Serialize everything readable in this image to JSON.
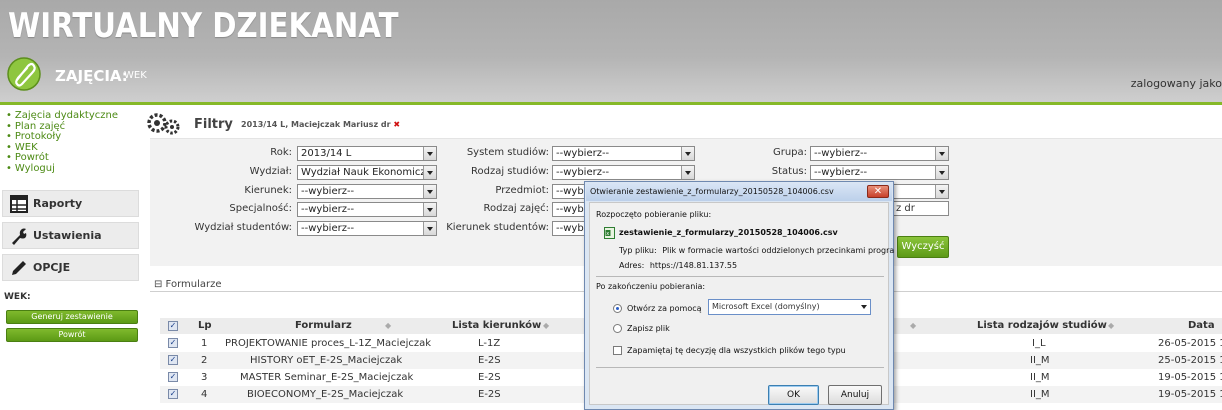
{
  "app": {
    "title": "WIRTUALNY DZIEKANAT",
    "section": "ZAJĘCIA:",
    "section_sub": "WEK",
    "user_label": "zalogowany jako"
  },
  "colors": {
    "accent": "#86b928",
    "nav_link": "#4c8a14",
    "close_x": "#d01010"
  },
  "sidebar": {
    "nav": [
      "Zajęcia dydaktyczne",
      "Plan zajęć",
      "Protokoły",
      "WEK",
      "Powrót",
      "Wyloguj"
    ],
    "buttons": [
      {
        "label": "Raporty",
        "icon": "table-icon"
      },
      {
        "label": "Ustawienia",
        "icon": "wrench-icon"
      },
      {
        "label": "OPCJE",
        "icon": "pencil-icon"
      }
    ],
    "wek_label": "WEK:",
    "generate_label": "Generuj zestawienie",
    "back_label": "Powrót"
  },
  "filters": {
    "title": "Filtry",
    "subtitle": "2013/14 L,   Maciejczak Mariusz dr",
    "rok_label": "Rok:",
    "rok_value": "2013/14 L",
    "wydzial_label": "Wydział:",
    "wydzial_value": "Wydział Nauk Ekonomicznych",
    "kierunek_label": "Kierunek:",
    "kierunek_value": "--wybierz--",
    "specjalnosc_label": "Specjalność:",
    "specjalnosc_value": "--wybierz--",
    "wydzial_studentow_label": "Wydział studentów:",
    "wydzial_studentow_value": "--wybierz--",
    "system_label": "System studiów:",
    "system_value": "--wybierz--",
    "rodzaj_studiow_label": "Rodzaj studiów:",
    "rodzaj_studiow_value": "--wybierz--",
    "przedmiot_label": "Przedmiot:",
    "przedmiot_value": "--wybi",
    "rodzaj_zajec_label": "Rodzaj zajęć:",
    "rodzaj_zajec_value": "--wybi",
    "kierunek_studentow_label": "Kierunek studentów:",
    "kierunek_studentow_value": "--wybi",
    "grupa_label": "Grupa:",
    "grupa_value": "--wybierz--",
    "status_label": "Status:",
    "status_value": "--wybierz--",
    "third_value": "",
    "prowadzacy_value": "z dr",
    "clear_label": "Wyczyść"
  },
  "table": {
    "section_label": "⊟ Formularze",
    "headers": {
      "lp": "Lp",
      "formularz": "Formularz",
      "kierunki": "Lista kierunków",
      "rodzaje": "Lista rodzajów studiów",
      "data": "Data"
    },
    "rows": [
      {
        "lp": "1",
        "formularz": "PROJEKTOWANIE proces_L-1Z_Maciejczak",
        "kierunek": "L-1Z",
        "rodzaj": "I_L",
        "data": "26-05-2015 1"
      },
      {
        "lp": "2",
        "formularz": "HISTORY oET_E-2S_Maciejczak",
        "kierunek": "E-2S",
        "rodzaj": "II_M",
        "data": "25-05-2015 1"
      },
      {
        "lp": "3",
        "formularz": "MASTER Seminar_E-2S_Maciejczak",
        "kierunek": "E-2S",
        "rodzaj": "II_M",
        "data": "19-05-2015 1"
      },
      {
        "lp": "4",
        "formularz": "BIOECONOMY_E-2S_Maciejczak",
        "kierunek": "E-2S",
        "rodzaj": "II_M",
        "data": "19-05-2015 1"
      }
    ]
  },
  "dialog": {
    "title": "Otwieranie zestawienie_z_formularzy_20150528_104006.csv",
    "intro": "Rozpoczęto pobieranie pliku:",
    "filename": "zestawienie_z_formularzy_20150528_104006.csv",
    "type_label": "Typ pliku:",
    "type_value": "Plik w formacie wartości oddzielonych przecinkami progra",
    "address_label": "Adres:",
    "address_value": "https://148.81.137.55",
    "after_label": "Po zakończeniu pobierania:",
    "open_with_label": "Otwórz za pomocą",
    "open_with_value": "Microsoft Excel (domyślny)",
    "save_label": "Zapisz plik",
    "remember_label": "Zapamiętaj tę decyzję dla wszystkich plików tego typu",
    "ok_label": "OK",
    "cancel_label": "Anuluj"
  }
}
